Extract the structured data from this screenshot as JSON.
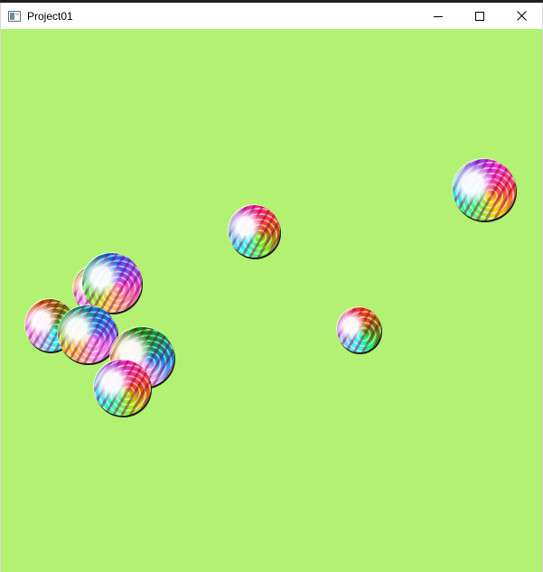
{
  "window": {
    "title": "Project01",
    "client_background": "#b3f172",
    "titlebar_background": "#ffffff"
  },
  "icons": {
    "app": "app-window-icon",
    "minimize": "minimize-icon",
    "maximize": "maximize-icon",
    "close": "close-icon"
  },
  "scene": {
    "ball_count": 9,
    "ball_style": "iridescent rainbow marbled sphere"
  }
}
